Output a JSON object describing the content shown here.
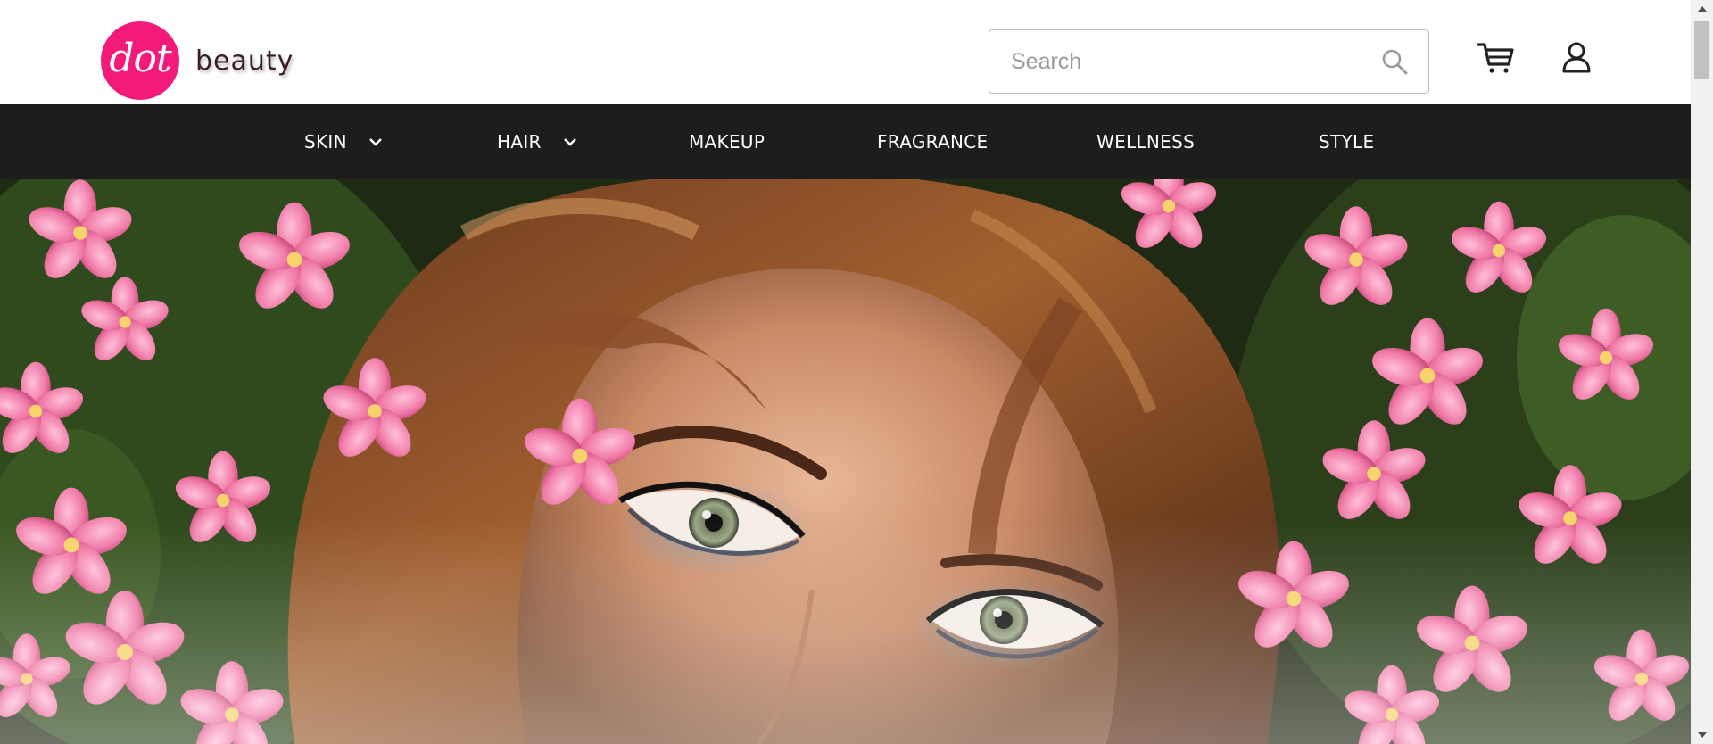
{
  "brand": {
    "logo_mark": "dot",
    "logo_word": "beauty",
    "accent_color": "#f41a7a"
  },
  "search": {
    "placeholder": "Search",
    "value": "",
    "icon": "search-icon"
  },
  "header_icons": {
    "cart": "cart-icon",
    "account": "user-icon"
  },
  "nav": {
    "background": "#1d1d1d",
    "items": [
      {
        "label": "SKIN",
        "has_dropdown": true
      },
      {
        "label": "HAIR",
        "has_dropdown": true
      },
      {
        "label": "MAKEUP",
        "has_dropdown": false
      },
      {
        "label": "FRAGRANCE",
        "has_dropdown": false
      },
      {
        "label": "WELLNESS",
        "has_dropdown": false
      },
      {
        "label": "STYLE",
        "has_dropdown": false
      }
    ]
  },
  "hero": {
    "image": "hero-image"
  }
}
